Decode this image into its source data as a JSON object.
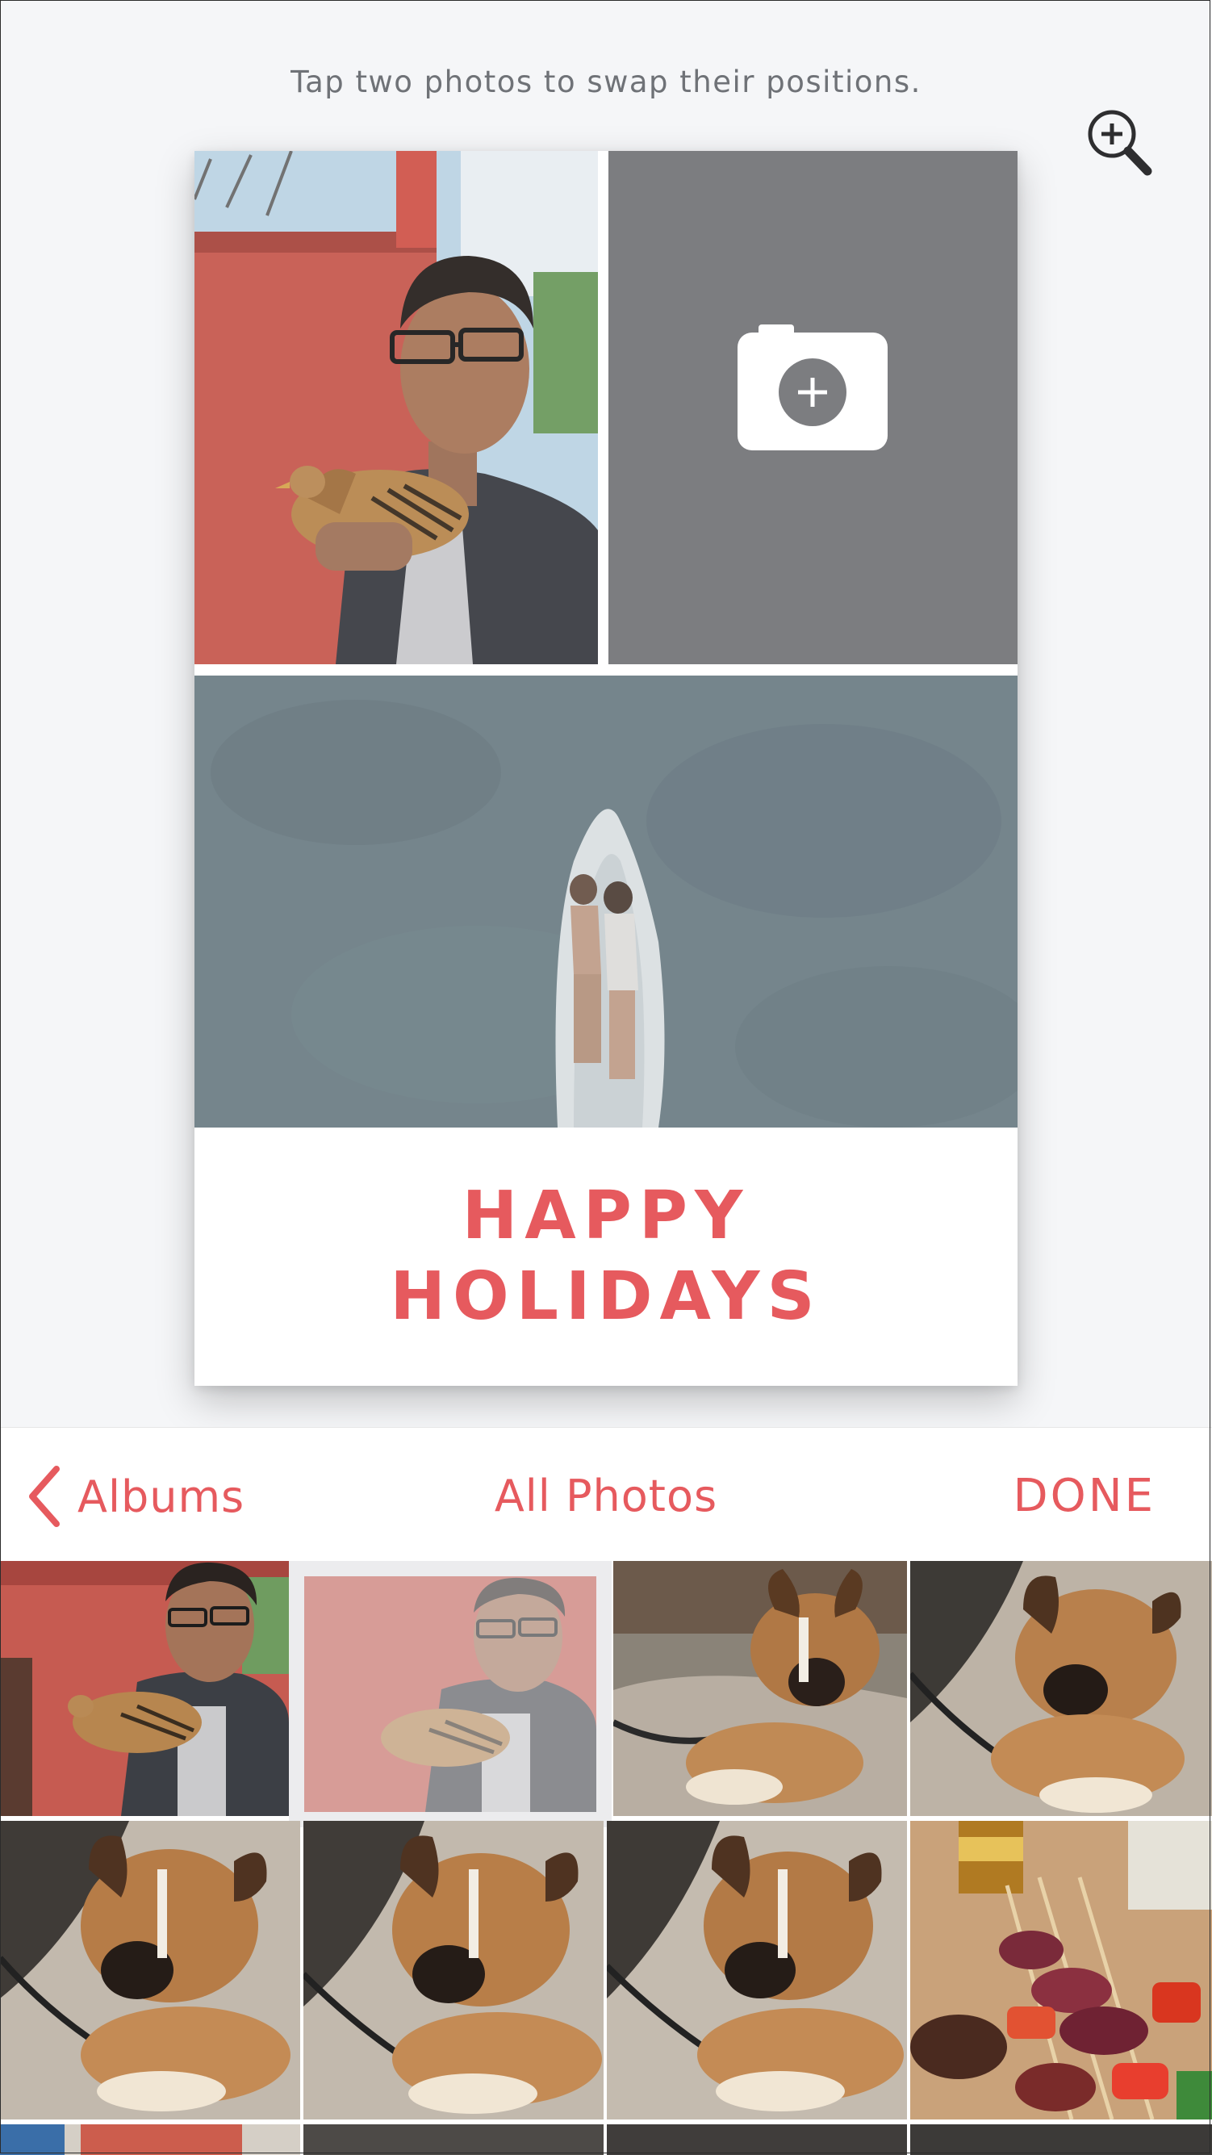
{
  "editor": {
    "instruction": "Tap two photos to swap their positions.",
    "card": {
      "line1": "HAPPY",
      "line2": "HOLIDAYS",
      "text_color": "#e65a5e",
      "empty_slot_color": "#7c7d80"
    }
  },
  "picker": {
    "back_label": "Albums",
    "title": "All Photos",
    "done_label": "DONE",
    "accent": "#e65a5e"
  },
  "icons": {
    "zoom": "zoom-in-icon",
    "add_photo": "add-photo-icon",
    "back": "chevron-left-icon"
  }
}
